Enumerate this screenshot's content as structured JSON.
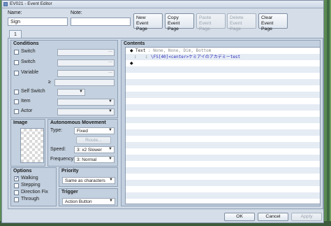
{
  "window": {
    "title": "EV021 - Event Editor"
  },
  "header": {
    "name_label": "Name:",
    "name_value": "Sign",
    "note_label": "Note:",
    "note_value": ""
  },
  "toolbar": {
    "new_page": "New\nEvent Page",
    "copy_page": "Copy\nEvent Page",
    "paste_page": "Paste\nEvent Page",
    "delete_page": "Delete\nEvent Page",
    "clear_page": "Clear\nEvent Page"
  },
  "tabs": [
    "1"
  ],
  "conditions": {
    "title": "Conditions",
    "switch1": "Switch",
    "switch2": "Switch",
    "variable": "Variable",
    "ge": "≥",
    "self_switch": "Self Switch",
    "item": "Item",
    "actor": "Actor",
    "ellipsis": "..."
  },
  "image": {
    "title": "Image"
  },
  "autonomous": {
    "title": "Autonomous Movement",
    "type_label": "Type:",
    "type_value": "Fixed",
    "route_button": "Route...",
    "speed_label": "Speed:",
    "speed_value": "3: x2 Slower",
    "freq_label": "Frequency:",
    "freq_value": "3: Normal"
  },
  "options": {
    "title": "Options",
    "walking": "Walking",
    "walking_checked": true,
    "stepping": "Stepping",
    "direction_fix": "Direction Fix",
    "through": "Through"
  },
  "priority": {
    "title": "Priority",
    "value": "Same as characters"
  },
  "trigger": {
    "title": "Trigger",
    "value": "Action Button"
  },
  "contents": {
    "title": "Contents",
    "line1_cmd": "Text",
    "line1_params": " : None, None, Dim, Bottom",
    "line2_prefix": ":",
    "line2_colon": ":",
    "line2_text": "\\FS[40]<center>ケミアイのアカデミーtest"
  },
  "footer": {
    "ok": "OK",
    "cancel": "Cancel",
    "apply": "Apply"
  },
  "colors": {
    "window_bg": "#d4dde8",
    "panel_bg": "#c3d0df",
    "row_alt": "#e5ecf4",
    "text_param": "#8a8a8a",
    "text_blue": "#2c2cb8"
  }
}
